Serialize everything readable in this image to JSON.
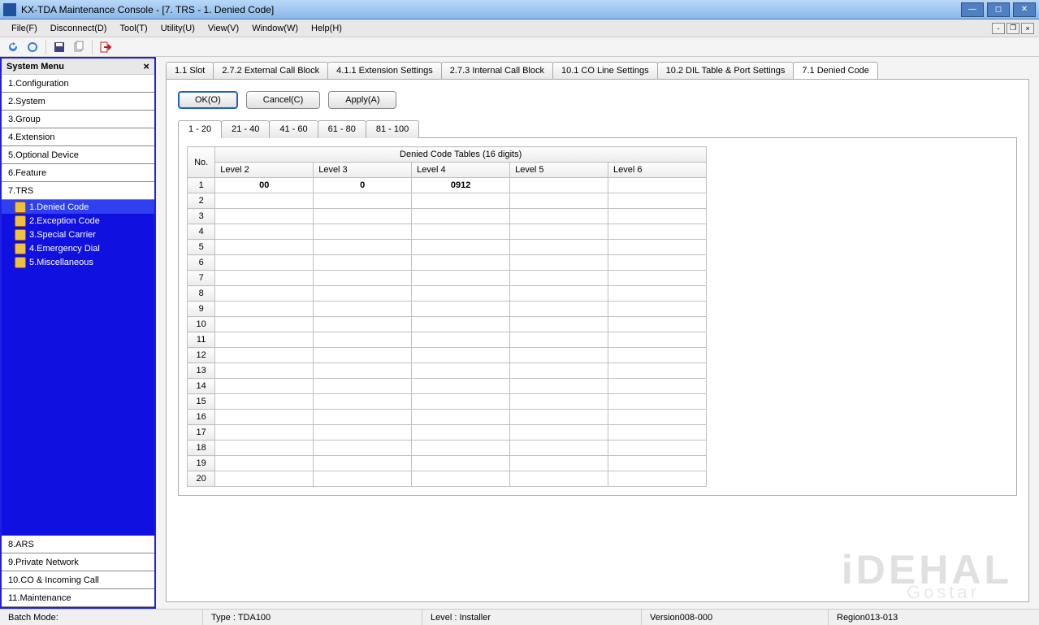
{
  "window": {
    "title": "KX-TDA Maintenance Console - [7. TRS - 1. Denied Code]"
  },
  "menubar": {
    "items": [
      "File(F)",
      "Disconnect(D)",
      "Tool(T)",
      "Utility(U)",
      "View(V)",
      "Window(W)",
      "Help(H)"
    ]
  },
  "sidebar": {
    "title": "System Menu",
    "items": [
      "1.Configuration",
      "2.System",
      "3.Group",
      "4.Extension",
      "5.Optional Device",
      "6.Feature",
      "7.TRS",
      "8.ARS",
      "9.Private Network",
      "10.CO & Incoming Call",
      "11.Maintenance"
    ],
    "tree_items": [
      "1.Denied Code",
      "2.Exception Code",
      "3.Special Carrier",
      "4.Emergency Dial",
      "5.Miscellaneous"
    ]
  },
  "top_tabs": [
    "1.1 Slot",
    "2.7.2 External Call Block",
    "4.1.1 Extension Settings",
    "2.7.3 Internal Call Block",
    "10.1 CO Line Settings",
    "10.2 DIL Table & Port Settings",
    "7.1 Denied Code"
  ],
  "buttons": {
    "ok": "OK(O)",
    "cancel": "Cancel(C)",
    "apply": "Apply(A)"
  },
  "range_tabs": [
    "1 - 20",
    "21 - 40",
    "41 - 60",
    "61 - 80",
    "81 - 100"
  ],
  "table": {
    "title": "Denied Code Tables (16 digits)",
    "no_header": "No.",
    "columns": [
      "Level 2",
      "Level 3",
      "Level 4",
      "Level 5",
      "Level 6"
    ],
    "rows": [
      {
        "no": "1",
        "cells": [
          "00",
          "0",
          "0912",
          "",
          ""
        ]
      },
      {
        "no": "2",
        "cells": [
          "",
          "",
          "",
          "",
          ""
        ]
      },
      {
        "no": "3",
        "cells": [
          "",
          "",
          "",
          "",
          ""
        ]
      },
      {
        "no": "4",
        "cells": [
          "",
          "",
          "",
          "",
          ""
        ]
      },
      {
        "no": "5",
        "cells": [
          "",
          "",
          "",
          "",
          ""
        ]
      },
      {
        "no": "6",
        "cells": [
          "",
          "",
          "",
          "",
          ""
        ]
      },
      {
        "no": "7",
        "cells": [
          "",
          "",
          "",
          "",
          ""
        ]
      },
      {
        "no": "8",
        "cells": [
          "",
          "",
          "",
          "",
          ""
        ]
      },
      {
        "no": "9",
        "cells": [
          "",
          "",
          "",
          "",
          ""
        ]
      },
      {
        "no": "10",
        "cells": [
          "",
          "",
          "",
          "",
          ""
        ]
      },
      {
        "no": "11",
        "cells": [
          "",
          "",
          "",
          "",
          ""
        ]
      },
      {
        "no": "12",
        "cells": [
          "",
          "",
          "",
          "",
          ""
        ]
      },
      {
        "no": "13",
        "cells": [
          "",
          "",
          "",
          "",
          ""
        ]
      },
      {
        "no": "14",
        "cells": [
          "",
          "",
          "",
          "",
          ""
        ]
      },
      {
        "no": "15",
        "cells": [
          "",
          "",
          "",
          "",
          ""
        ]
      },
      {
        "no": "16",
        "cells": [
          "",
          "",
          "",
          "",
          ""
        ]
      },
      {
        "no": "17",
        "cells": [
          "",
          "",
          "",
          "",
          ""
        ]
      },
      {
        "no": "18",
        "cells": [
          "",
          "",
          "",
          "",
          ""
        ]
      },
      {
        "no": "19",
        "cells": [
          "",
          "",
          "",
          "",
          ""
        ]
      },
      {
        "no": "20",
        "cells": [
          "",
          "",
          "",
          "",
          ""
        ]
      }
    ]
  },
  "statusbar": {
    "batch": "Batch Mode:",
    "type": "Type : TDA100",
    "level": "Level : Installer",
    "version": "Version008-000",
    "region": "Region013-013"
  }
}
